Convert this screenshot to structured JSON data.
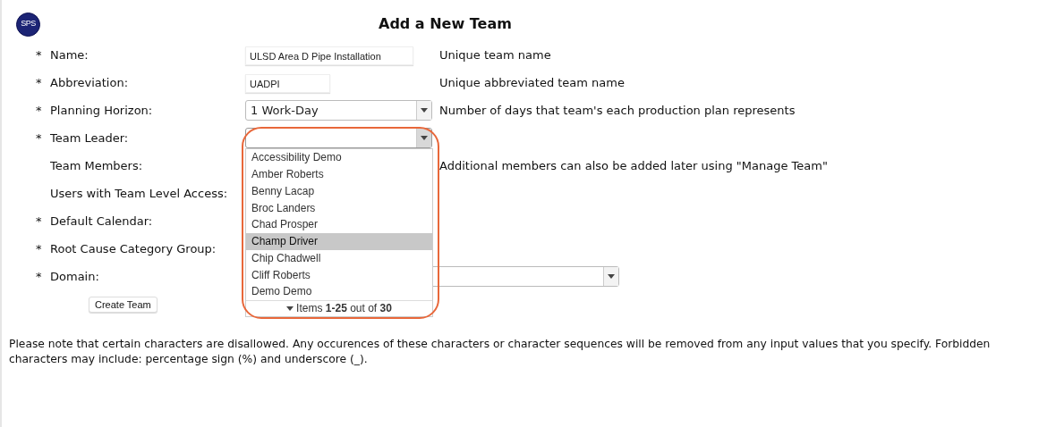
{
  "logo": {
    "text": "SPS"
  },
  "title": "Add a New Team",
  "fields": [
    {
      "marker": "*",
      "label": "Name:",
      "kind": "long_text",
      "value": "ULSD Area D Pipe Installation",
      "hint": "Unique team name"
    },
    {
      "marker": "*",
      "label": "Abbreviation:",
      "kind": "short_text",
      "value": "UADPI",
      "hint": "Unique abbreviated team name"
    },
    {
      "marker": "*",
      "label": "Planning Horizon:",
      "kind": "select",
      "value": "1 Work-Day",
      "hint": "Number of days that team's each production plan represents"
    },
    {
      "marker": "*",
      "label": "Team Leader:",
      "kind": "select",
      "open": true
    },
    {
      "label": "Team Members:",
      "kind": "covered",
      "hint": "Additional members can also be added later using \"Manage Team\""
    },
    {
      "label": "Users with Team Level Access:",
      "kind": "covered"
    },
    {
      "marker": "*",
      "label": "Default Calendar:",
      "kind": "covered"
    },
    {
      "marker": "*",
      "label": "Root Cause Category Group:",
      "kind": "covered"
    },
    {
      "marker": "*",
      "label": "Domain:",
      "kind": "wide_select"
    }
  ],
  "create_button": "Create Team",
  "team_leader_dropdown": {
    "options": [
      {
        "label": "Accessibility Demo",
        "selected": false
      },
      {
        "label": "Amber Roberts",
        "selected": false
      },
      {
        "label": "Benny Lacap",
        "selected": false
      },
      {
        "label": "Broc Landers",
        "selected": false
      },
      {
        "label": "Chad Prosper",
        "selected": false
      },
      {
        "label": "Champ Driver",
        "selected": true
      },
      {
        "label": "Chip Chadwell",
        "selected": false
      },
      {
        "label": "Cliff Roberts",
        "selected": false
      },
      {
        "label": "Demo Demo",
        "selected": false
      }
    ],
    "footer": "Items **1-25** out of **30**"
  },
  "note": "Please note that certain characters are disallowed. Any occurences of these characters or character sequences will be removed from any input values that you specify. Forbidden characters may include: percentage sign (%) and underscore (_)."
}
